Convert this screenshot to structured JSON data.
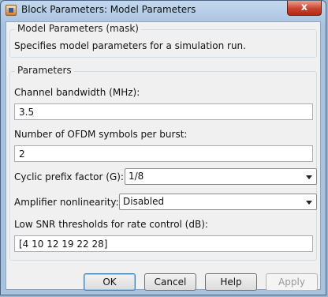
{
  "window": {
    "title": "Block Parameters: Model Parameters",
    "close_symbol": "x"
  },
  "mask": {
    "group_title": "Model Parameters (mask)",
    "description": "Specifies model parameters for a simulation run."
  },
  "parameters": {
    "group_title": "Parameters",
    "channel_bandwidth": {
      "label": "Channel bandwidth (MHz):",
      "value": "3.5"
    },
    "ofdm_symbols": {
      "label": "Number of OFDM symbols per burst:",
      "value": "2"
    },
    "cyclic_prefix": {
      "label": "Cyclic prefix factor (G):",
      "value": "1/8"
    },
    "amplifier": {
      "label": "Amplifier nonlinearity:",
      "value": "Disabled"
    },
    "snr_thresholds": {
      "label": "Low SNR thresholds for rate control (dB):",
      "value": "[4 10 12 19 22 28]"
    }
  },
  "buttons": {
    "ok": "OK",
    "cancel": "Cancel",
    "help": "Help",
    "apply": "Apply"
  }
}
